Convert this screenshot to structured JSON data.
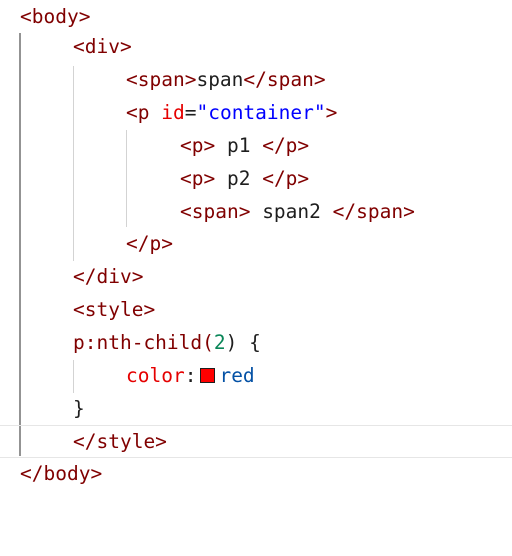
{
  "editor": {
    "line1": {
      "tag_open": "<body>"
    },
    "line2": {
      "tag_open": "<div>"
    },
    "line3": {
      "open": "<span>",
      "text": "span",
      "close": "</span>"
    },
    "line4": {
      "open_start": "<p ",
      "attr": "id",
      "eq": "=",
      "value": "\"container\"",
      "open_end": ">"
    },
    "line5": {
      "open": "<p>",
      "text": " p1 ",
      "close": "</p>"
    },
    "line6": {
      "open": "<p>",
      "text": " p2 ",
      "close": "</p>"
    },
    "line7": {
      "open": "<span>",
      "text": " span2 ",
      "close": "</span>"
    },
    "line8": {
      "tag_close": "</p>"
    },
    "line9": {
      "tag_close": "</div>"
    },
    "line10": {
      "tag_open": "<style>"
    },
    "line11": {
      "selector_a": "p:nth-child(",
      "num": "2",
      "selector_b": ") {"
    },
    "line12": {
      "prop": "color",
      "colon": ":",
      "value": "red",
      "swatch_color": "#ff0000"
    },
    "line13": {
      "brace": "}"
    },
    "line14": {
      "tag_close": "</style>"
    },
    "line15": {
      "tag_close": "</body>"
    }
  }
}
